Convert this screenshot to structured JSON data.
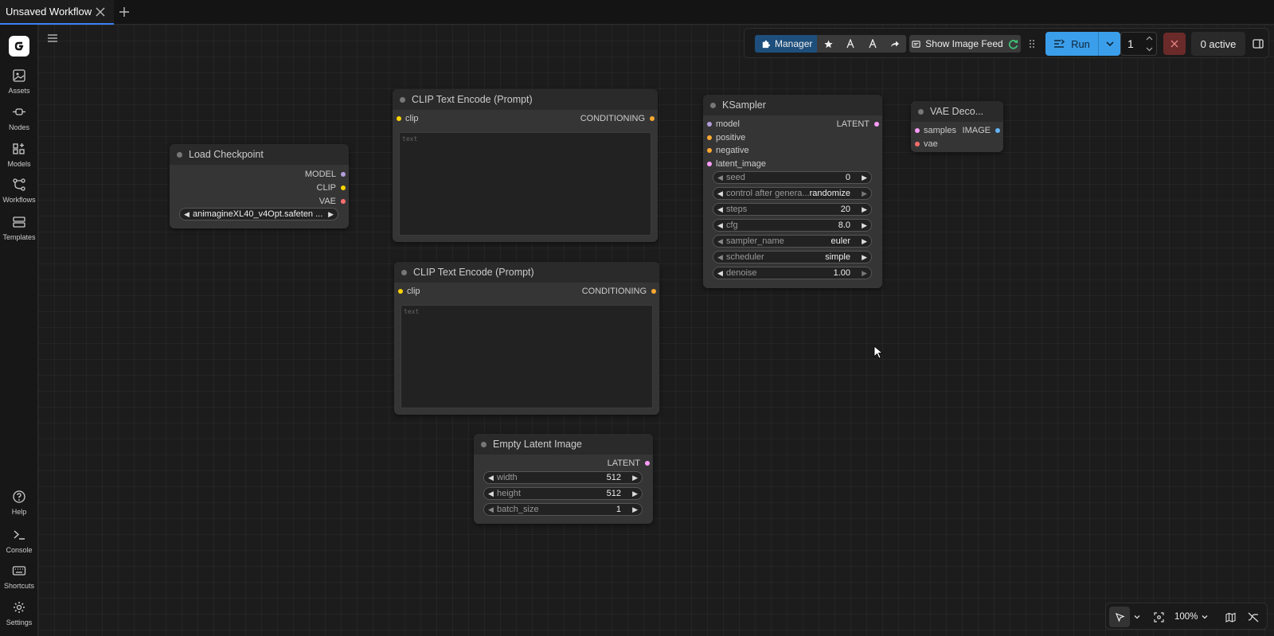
{
  "tab": {
    "title": "Unsaved Workflow"
  },
  "sidebar": {
    "items": [
      {
        "label": "Assets",
        "icon": "image-icon"
      },
      {
        "label": "Nodes",
        "icon": "node-icon"
      },
      {
        "label": "Models",
        "icon": "models-icon"
      },
      {
        "label": "Workflows",
        "icon": "workflow-icon"
      },
      {
        "label": "Templates",
        "icon": "templates-icon"
      },
      {
        "label": "Help",
        "icon": "help-icon"
      },
      {
        "label": "Console",
        "icon": "console-icon"
      },
      {
        "label": "Shortcuts",
        "icon": "keyboard-icon"
      },
      {
        "label": "Settings",
        "icon": "gear-icon"
      }
    ]
  },
  "toolbar": {
    "manager_label": "Manager",
    "show_feed_label": "Show Image Feed",
    "run_label": "Run",
    "queue_count": "1",
    "active_label": "0 active"
  },
  "nodes": {
    "load_checkpoint": {
      "title": "Load Checkpoint",
      "outputs": [
        "MODEL",
        "CLIP",
        "VAE"
      ],
      "ckpt_value": "animagineXL40_v4Opt.safeten ..."
    },
    "clip1": {
      "title": "CLIP Text Encode (Prompt)",
      "input": "clip",
      "output": "CONDITIONING",
      "placeholder": "text"
    },
    "clip2": {
      "title": "CLIP Text Encode (Prompt)",
      "input": "clip",
      "output": "CONDITIONING",
      "placeholder": "text"
    },
    "ksampler": {
      "title": "KSampler",
      "inputs": [
        "model",
        "positive",
        "negative",
        "latent_image"
      ],
      "output": "LATENT",
      "widgets": [
        {
          "label": "seed",
          "value": "0"
        },
        {
          "label": "control after genera...",
          "value": "randomize"
        },
        {
          "label": "steps",
          "value": "20"
        },
        {
          "label": "cfg",
          "value": "8.0"
        },
        {
          "label": "sampler_name",
          "value": "euler"
        },
        {
          "label": "scheduler",
          "value": "simple"
        },
        {
          "label": "denoise",
          "value": "1.00"
        }
      ]
    },
    "vae_decode": {
      "title": "VAE Deco...",
      "inputs": [
        "samples",
        "vae"
      ],
      "output": "IMAGE"
    },
    "empty_latent": {
      "title": "Empty Latent Image",
      "output": "LATENT",
      "widgets": [
        {
          "label": "width",
          "value": "512"
        },
        {
          "label": "height",
          "value": "512"
        },
        {
          "label": "batch_size",
          "value": "1"
        }
      ]
    }
  },
  "bottom": {
    "zoom": "100%"
  },
  "colors": {
    "accent": "#3b9eea",
    "model": "#b39ddb",
    "clip": "#ffd500",
    "vae": "#ff6e6e",
    "conditioning": "#ffa931",
    "latent": "#ff9cf9",
    "image": "#64b5f6"
  }
}
